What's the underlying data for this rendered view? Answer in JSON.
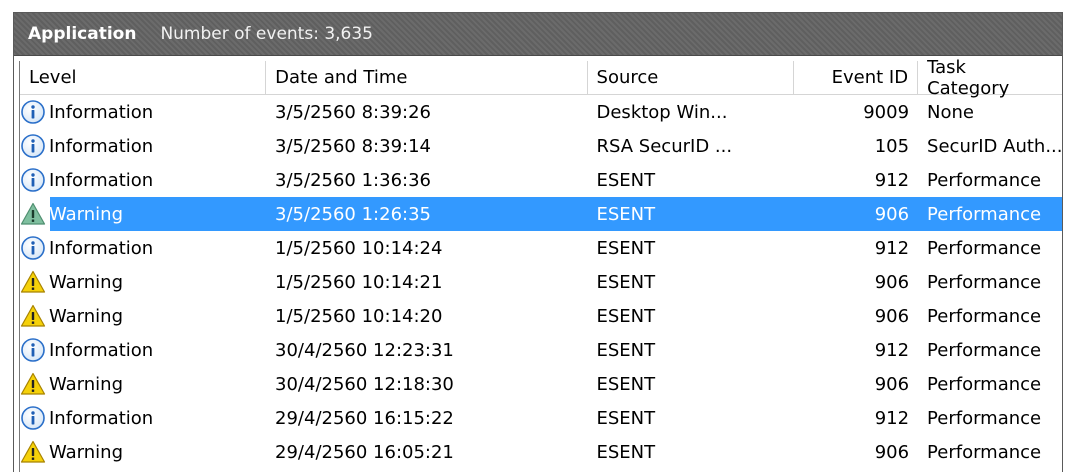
{
  "header": {
    "app": "Application",
    "count": "Number of events: 3,635"
  },
  "columns": [
    "Level",
    "Date and Time",
    "Source",
    "Event ID",
    "Task Category"
  ],
  "rows": [
    {
      "level": "Information",
      "icon": "info-icon",
      "date": "3/5/2560 8:39:26",
      "source": "Desktop Win...",
      "id": "9009",
      "task": "None",
      "selected": false
    },
    {
      "level": "Information",
      "icon": "info-icon",
      "date": "3/5/2560 8:39:14",
      "source": "RSA SecurID ...",
      "id": "105",
      "task": "SecurID Auth...",
      "selected": false
    },
    {
      "level": "Information",
      "icon": "info-icon",
      "date": "3/5/2560 1:36:36",
      "source": "ESENT",
      "id": "912",
      "task": "Performance",
      "selected": false
    },
    {
      "level": "Warning",
      "icon": "warning-icon",
      "date": "3/5/2560 1:26:35",
      "source": "ESENT",
      "id": "906",
      "task": "Performance",
      "selected": true
    },
    {
      "level": "Information",
      "icon": "info-icon",
      "date": "1/5/2560 10:14:24",
      "source": "ESENT",
      "id": "912",
      "task": "Performance",
      "selected": false
    },
    {
      "level": "Warning",
      "icon": "warning-icon",
      "date": "1/5/2560 10:14:21",
      "source": "ESENT",
      "id": "906",
      "task": "Performance",
      "selected": false
    },
    {
      "level": "Warning",
      "icon": "warning-icon",
      "date": "1/5/2560 10:14:20",
      "source": "ESENT",
      "id": "906",
      "task": "Performance",
      "selected": false
    },
    {
      "level": "Information",
      "icon": "info-icon",
      "date": "30/4/2560 12:23:31",
      "source": "ESENT",
      "id": "912",
      "task": "Performance",
      "selected": false
    },
    {
      "level": "Warning",
      "icon": "warning-icon",
      "date": "30/4/2560 12:18:30",
      "source": "ESENT",
      "id": "906",
      "task": "Performance",
      "selected": false
    },
    {
      "level": "Information",
      "icon": "info-icon",
      "date": "29/4/2560 16:15:22",
      "source": "ESENT",
      "id": "912",
      "task": "Performance",
      "selected": false
    },
    {
      "level": "Warning",
      "icon": "warning-icon",
      "date": "29/4/2560 16:05:21",
      "source": "ESENT",
      "id": "906",
      "task": "Performance",
      "selected": false
    }
  ],
  "colors": {
    "selection": "#3399ff",
    "info_blue": "#2a6fc9",
    "warning_yellow": "#f5d10a"
  }
}
